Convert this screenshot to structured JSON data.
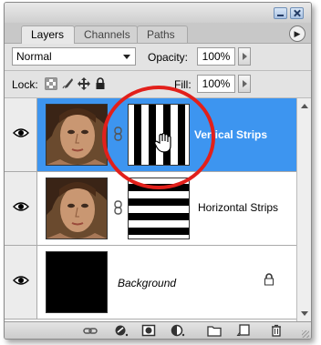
{
  "window": {
    "controls": [
      "minimize-icon",
      "close-icon"
    ]
  },
  "tabs": [
    {
      "label": "Layers",
      "active": true
    },
    {
      "label": "Channels",
      "active": false
    },
    {
      "label": "Paths",
      "active": false
    }
  ],
  "menu_icon": "flyout-menu-icon",
  "options": {
    "blend_mode": "Normal",
    "opacity_label": "Opacity:",
    "opacity_value": "100%",
    "lock_label": "Lock:",
    "lock_icons": [
      "lock-transparent-pixels-icon",
      "lock-image-pixels-icon",
      "lock-position-icon",
      "lock-all-icon"
    ],
    "fill_label": "Fill:",
    "fill_value": "100%"
  },
  "layers": [
    {
      "name": "Vertical Strips",
      "selected": true,
      "visible": true,
      "mask": "vertical-stripes"
    },
    {
      "name": "Horizontal Strips",
      "selected": false,
      "visible": true,
      "mask": "horizontal-stripes"
    },
    {
      "name": "Background",
      "selected": false,
      "visible": true,
      "locked": true
    }
  ],
  "bottom_toolbar": [
    "link-layers-icon",
    "layer-style-icon",
    "add-mask-icon",
    "adjustment-layer-icon",
    "new-group-icon",
    "new-layer-icon",
    "delete-layer-icon"
  ],
  "colors": {
    "selection": "#3d95f0",
    "highlight_circle": "#e2201b",
    "panel_bg": "#dcdcdc"
  }
}
